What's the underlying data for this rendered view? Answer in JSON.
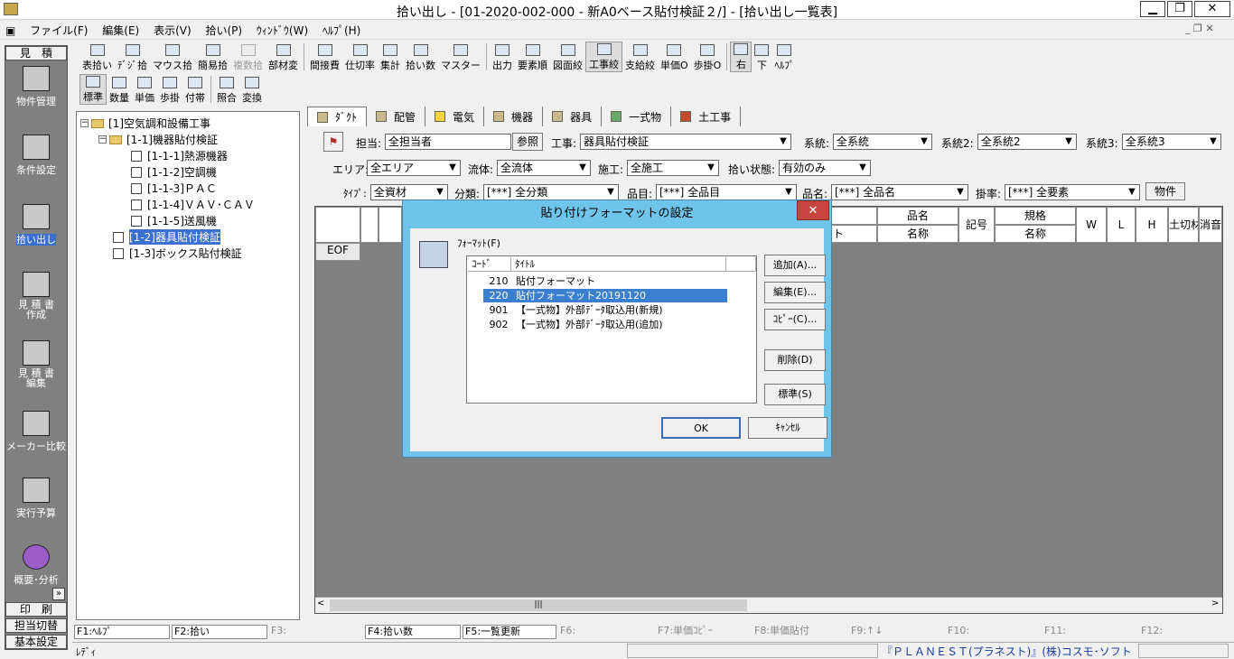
{
  "window": {
    "title": "拾い出し - [01-2020-002-000 - 新A0ベース貼付検証２/] - [拾い出し一覧表]",
    "minimize": "▁",
    "restore": "❐",
    "close": "✕"
  },
  "menu": [
    "ファイル(F)",
    "編集(E)",
    "表示(V)",
    "拾い(P)",
    "ｳｨﾝﾄﾞｳ(W)",
    "ﾍﾙﾌﾟ(H)"
  ],
  "toolbar1": [
    {
      "label": "表拾い",
      "icon": "table-pick-icon"
    },
    {
      "label": "ﾃﾞｼﾞ拾",
      "icon": "digitizer-icon"
    },
    {
      "label": "マウス拾",
      "icon": "mouse-icon"
    },
    {
      "label": "簡易拾",
      "icon": "simple-pick-icon"
    },
    {
      "label": "複数拾",
      "icon": "multi-pick-icon",
      "disabled": true
    },
    {
      "label": "部材変",
      "icon": "part-change-icon"
    },
    {
      "label": "間接費",
      "icon": "indirect-cost-icon"
    },
    {
      "label": "仕切率",
      "icon": "rate-icon"
    },
    {
      "label": "集計",
      "icon": "sigma-icon"
    },
    {
      "label": "拾い数",
      "icon": "count-icon"
    },
    {
      "label": "マスター",
      "icon": "master-icon"
    },
    {
      "label": "出力",
      "icon": "output-icon"
    },
    {
      "label": "要素順",
      "icon": "sort-icon"
    },
    {
      "label": "図面絞",
      "icon": "drawing-filter-icon"
    },
    {
      "label": "工事絞",
      "icon": "work-filter-icon",
      "active": true
    },
    {
      "label": "支給絞",
      "icon": "supply-filter-icon"
    },
    {
      "label": "単価O",
      "icon": "unit-price-icon"
    },
    {
      "label": "歩掛O",
      "icon": "labor-rate-icon"
    },
    {
      "label": "右",
      "icon": "right-icon",
      "active": true
    },
    {
      "label": "下",
      "icon": "down-icon"
    },
    {
      "label": "ﾍﾙﾌﾟ",
      "icon": "help-icon"
    }
  ],
  "toolbar2": [
    {
      "label": "標準",
      "icon": "standard-icon",
      "active": true
    },
    {
      "label": "数量",
      "icon": "quantity-icon"
    },
    {
      "label": "単価",
      "icon": "price-icon"
    },
    {
      "label": "歩掛",
      "icon": "labor-icon"
    },
    {
      "label": "付帯",
      "icon": "incidental-icon"
    },
    {
      "label": "照合",
      "icon": "check-icon"
    },
    {
      "label": "変換",
      "icon": "convert-icon"
    }
  ],
  "sidebar": {
    "header": "見　積",
    "items": [
      "物件管理",
      "条件設定",
      "拾い出し",
      "見 積 書\n作成",
      "見 積 書\n編集",
      "メーカー比較",
      "実行予算",
      "概要･分析"
    ],
    "more": "»",
    "print": "印　刷",
    "switch": "担当切替",
    "basic": "基本設定"
  },
  "tree": [
    {
      "label": "[1]空気調和設備工事"
    },
    {
      "label": "[1-1]機器貼付検証"
    },
    {
      "label": "[1-1-1]熱源機器"
    },
    {
      "label": "[1-1-2]空調機"
    },
    {
      "label": "[1-1-3]ＰＡＣ"
    },
    {
      "label": "[1-1-4]ＶＡＶ･ＣＡＶ"
    },
    {
      "label": "[1-1-5]送風機"
    },
    {
      "label": "[1-2]器具貼付検証"
    },
    {
      "label": "[1-3]ボックス貼付検証"
    }
  ],
  "tabs": [
    "ﾀﾞｸﾄ",
    "配管",
    "電気",
    "機器",
    "器具",
    "一式物",
    "土工事"
  ],
  "filters": {
    "tanto_label": "担当:",
    "tanto": "全担当者",
    "ref_button": "参照",
    "koji_label": "工事:",
    "koji": "器具貼付検証",
    "keito_label": "系統:",
    "keito": "全系統",
    "keito2_label": "系統2:",
    "keito2": "全系統2",
    "keito3_label": "系統3:",
    "keito3": "全系統3",
    "area_label": "エリア:",
    "area": "全エリア",
    "ryutai_label": "流体:",
    "ryutai": "全流体",
    "seko_label": "施工:",
    "seko": "全施工",
    "state_label": "拾い状態:",
    "state": "有効のみ",
    "type_label": "ﾀｲﾌﾟ:",
    "type": "全資材",
    "bunrui_label": "分類:",
    "bunrui": "[***] 全分類",
    "hinmoku_label": "品目:",
    "hinmoku": "[***] 全品目",
    "hinmei_label": "品名:",
    "hinmei": "[***] 全品名",
    "kakeritsu_label": "掛率:",
    "kakeritsu": "[***] 全要素",
    "bukken_button": "物件"
  },
  "grid": {
    "eof": "EOF",
    "headers": {
      "hinmei_top": "品名",
      "hinmei_bottom": "名称",
      "kigo": "記号",
      "kikaku_top": "規格",
      "kikaku_bottom": "名称",
      "w": "W",
      "l": "L",
      "h": "H",
      "dokiri": "土切材",
      "shoon": "消音",
      "partial": "ト"
    }
  },
  "dialog": {
    "title": "貼り付けフォーマットの設定",
    "close": "✕",
    "format_label": "ﾌｫｰﾏｯﾄ(F)",
    "columns": [
      "ｺｰﾄﾞ",
      "ﾀｲﾄﾙ"
    ],
    "rows": [
      {
        "code": "210",
        "title": "貼付フォーマット"
      },
      {
        "code": "220",
        "title": "貼付フォーマット20191120",
        "selected": true
      },
      {
        "code": "901",
        "title": "【一式物】外部ﾃﾞｰﾀ取込用(新規)"
      },
      {
        "code": "902",
        "title": "【一式物】外部ﾃﾞｰﾀ取込用(追加)"
      }
    ],
    "buttons": {
      "add": "追加(A)...",
      "edit": "編集(E)...",
      "copy": "ｺﾋﾟｰ(C)...",
      "delete": "削除(D)",
      "standard": "標準(S)",
      "ok": "OK",
      "cancel": "ｷｬﾝｾﾙ"
    }
  },
  "fkeys": [
    {
      "label": "F1:ﾍﾙﾌﾟ",
      "box": true
    },
    {
      "label": "F2:拾い",
      "box": true
    },
    {
      "label": "F3:",
      "box": false
    },
    {
      "label": "F4:拾い数",
      "box": true
    },
    {
      "label": "F5:一覧更新",
      "box": true
    },
    {
      "label": "F6:",
      "box": false
    },
    {
      "label": "F7:単価ｺﾋﾟｰ",
      "box": false
    },
    {
      "label": "F8:単価貼付",
      "box": false
    },
    {
      "label": "F9:↑↓",
      "box": false
    },
    {
      "label": "F10:",
      "box": false
    },
    {
      "label": "F11:",
      "box": false
    },
    {
      "label": "F12:",
      "box": false
    }
  ],
  "status": {
    "ready": "ﾚﾃﾞｨ",
    "company": "『ＰＬＡＮＥＳＴ(プラネスト)』(株)コスモ･ソフト"
  }
}
